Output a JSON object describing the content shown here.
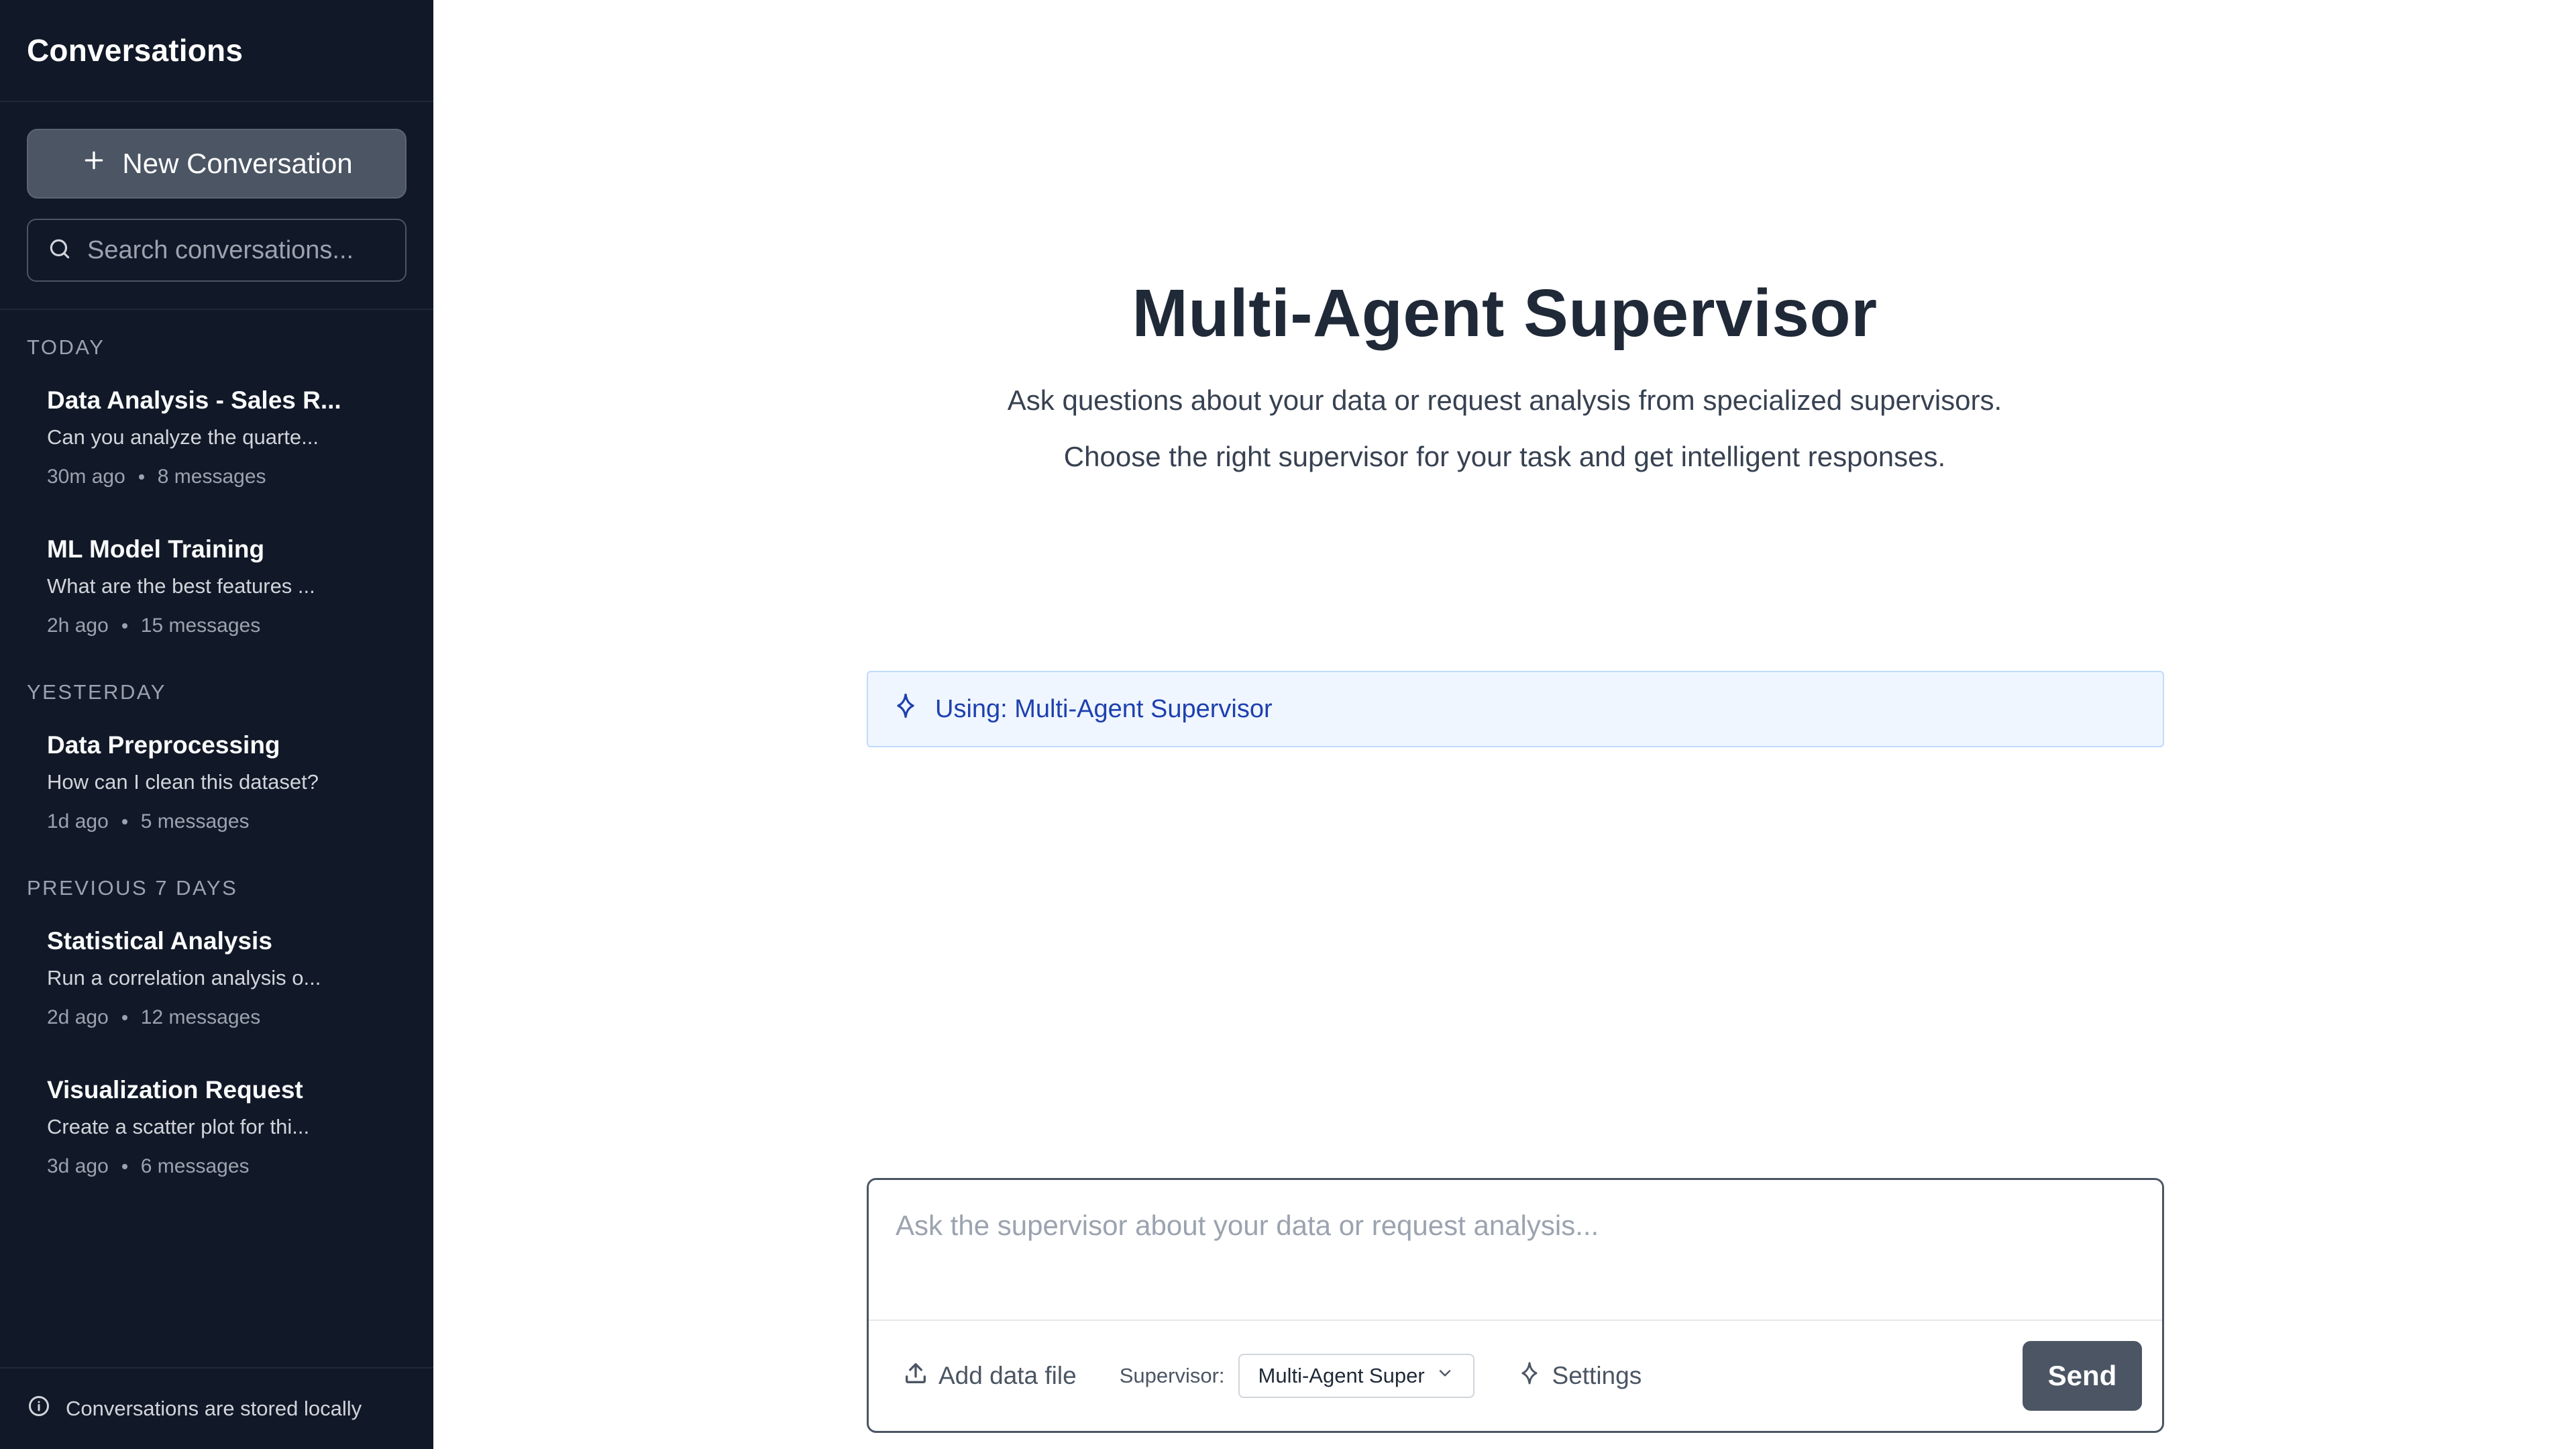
{
  "sidebar": {
    "title": "Conversations",
    "new_button_label": "New Conversation",
    "search_placeholder": "Search conversations...",
    "groups": [
      {
        "label": "Today",
        "items": [
          {
            "title": "Data Analysis - Sales R...",
            "preview": "Can you analyze the quarte...",
            "time": "30m ago",
            "count": "8 messages"
          },
          {
            "title": "ML Model Training",
            "preview": "What are the best features ...",
            "time": "2h ago",
            "count": "15 messages"
          }
        ]
      },
      {
        "label": "Yesterday",
        "items": [
          {
            "title": "Data Preprocessing",
            "preview": "How can I clean this dataset?",
            "time": "1d ago",
            "count": "5 messages"
          }
        ]
      },
      {
        "label": "Previous 7 Days",
        "items": [
          {
            "title": "Statistical Analysis",
            "preview": "Run a correlation analysis o...",
            "time": "2d ago",
            "count": "12 messages"
          },
          {
            "title": "Visualization Request",
            "preview": "Create a scatter plot for thi...",
            "time": "3d ago",
            "count": "6 messages"
          }
        ]
      }
    ],
    "footer_text": "Conversations are stored locally"
  },
  "main": {
    "title": "Multi-Agent Supervisor",
    "subtitle_line1": "Ask questions about your data or request analysis from specialized supervisors.",
    "subtitle_line2": "Choose the right supervisor for your task and get intelligent responses.",
    "using_banner": "Using: Multi-Agent Supervisor",
    "composer": {
      "placeholder": "Ask the supervisor about your data or request analysis...",
      "add_file_label": "Add data file",
      "supervisor_label": "Supervisor:",
      "supervisor_value": "Multi-Agent Super",
      "settings_label": "Settings",
      "send_label": "Send"
    }
  },
  "colors": {
    "sidebar_bg": "#111827",
    "accent": "#4b5563",
    "banner_bg": "#eff6ff",
    "banner_text": "#1e40af"
  }
}
